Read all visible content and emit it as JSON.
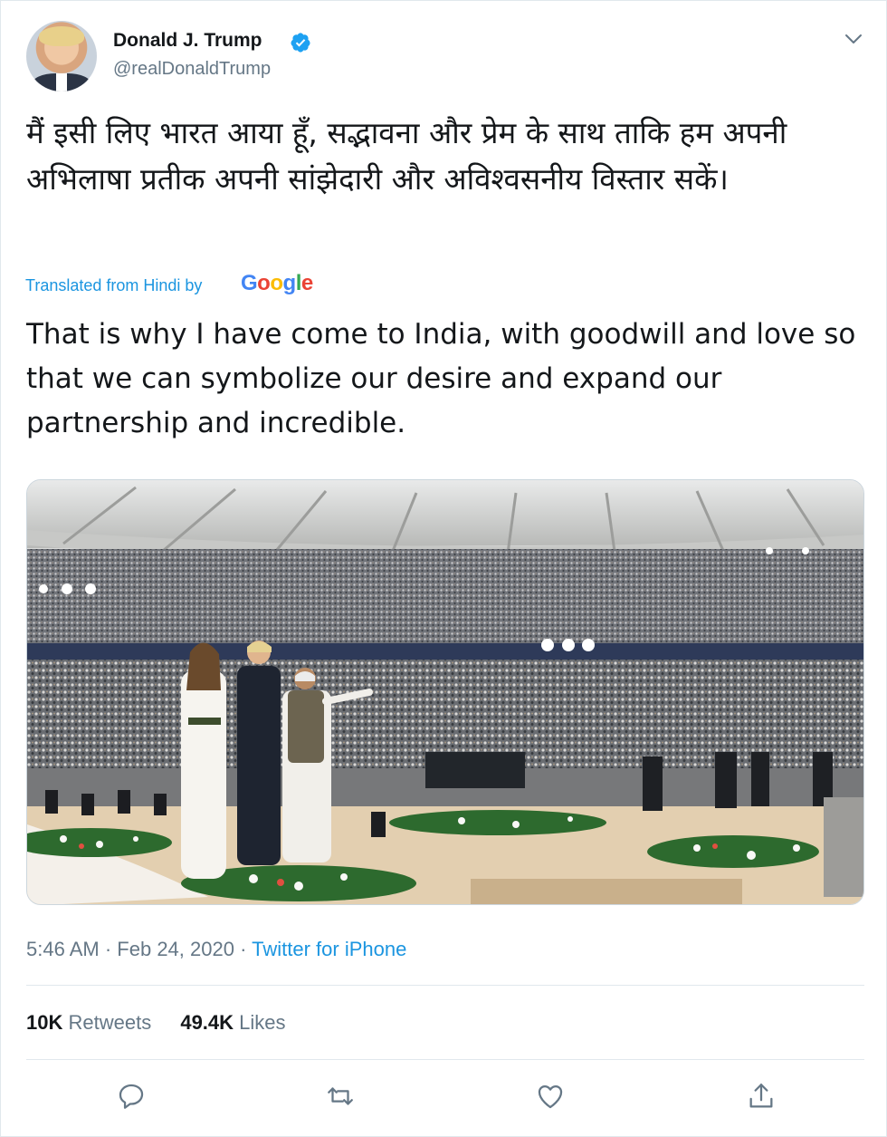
{
  "tweet": {
    "author_name": "Donald J. Trump",
    "handle": "@realDonaldTrump",
    "hindi_text": "मैं इसी लिए भारत आया हूँ, सद्भावना और प्रेम के साथ ताकि हम अपनी अभिलाषा प्रतीक अपनी सांझेदारी और अविश्वसनीय विस्तार सकें।",
    "translated_label": "Translated from Hindi by",
    "translator_logo": "Google",
    "english_text": "That is why I have come to India, with goodwill and love so that we can symbolize our desire and expand our partnership and incredible.",
    "time": "5:46 AM",
    "date": "Feb 24, 2020",
    "separator": "·",
    "source": "Twitter for iPhone",
    "retweets_count": "10K",
    "retweets_label": "Retweets",
    "likes_count": "49.4K",
    "likes_label": "Likes"
  },
  "icons": {
    "verified": "verified-badge-icon",
    "caret": "chevron-down-icon",
    "reply": "reply-icon",
    "retweet": "retweet-icon",
    "like": "heart-icon",
    "share": "share-icon"
  },
  "colors": {
    "link_blue": "#1b95e0",
    "muted_gray": "#657786",
    "text": "#14171a",
    "border": "#e1e8ed"
  }
}
